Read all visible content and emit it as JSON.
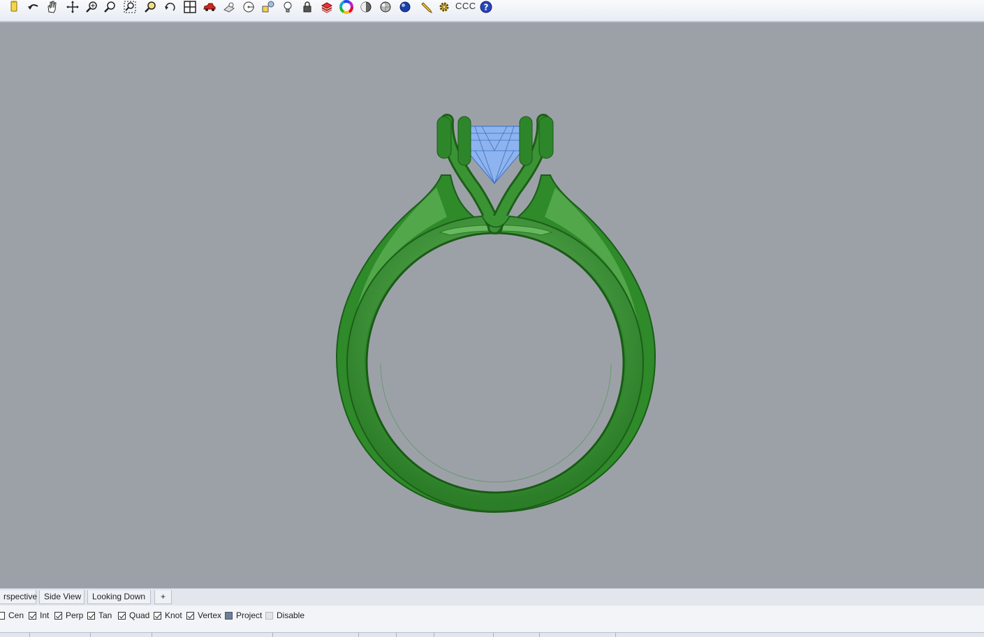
{
  "toolbar": {
    "icons": [
      "new-file-icon",
      "undo-icon",
      "pan-hand-icon",
      "move-view-icon",
      "zoom-icon",
      "zoom-dynamic-icon",
      "zoom-window-icon",
      "zoom-selected-icon",
      "rotate-view-icon",
      "four-viewports-icon",
      "car-icon",
      "named-views-icon",
      "target-icon",
      "shapes-icon",
      "lightbulb-icon",
      "lock-icon",
      "layers-book-icon",
      "color-wheel-icon",
      "shaded-sphere-icon",
      "rendered-sphere-icon",
      "blue-sphere-icon",
      "pencil-icon",
      "gear-settings-icon",
      "help-icon"
    ],
    "text_label": "CCC"
  },
  "viewport": {
    "background": "#9ca1a8",
    "ring_color": "#2f8a2a",
    "gem_color": "#8db4ee"
  },
  "tabs": [
    {
      "label": "rspective"
    },
    {
      "label": "Side View"
    },
    {
      "label": "Looking Down"
    },
    {
      "label": "+"
    }
  ],
  "osnaps": [
    {
      "label": "Cen",
      "state": "unchecked"
    },
    {
      "label": "Int",
      "state": "checked"
    },
    {
      "label": "Perp",
      "state": "checked"
    },
    {
      "label": "Tan",
      "state": "checked"
    },
    {
      "label": "Quad",
      "state": "checked"
    },
    {
      "label": "Knot",
      "state": "checked"
    },
    {
      "label": "Vertex",
      "state": "checked"
    },
    {
      "label": "Project",
      "state": "filled"
    },
    {
      "label": "Disable",
      "state": "disabled"
    }
  ]
}
